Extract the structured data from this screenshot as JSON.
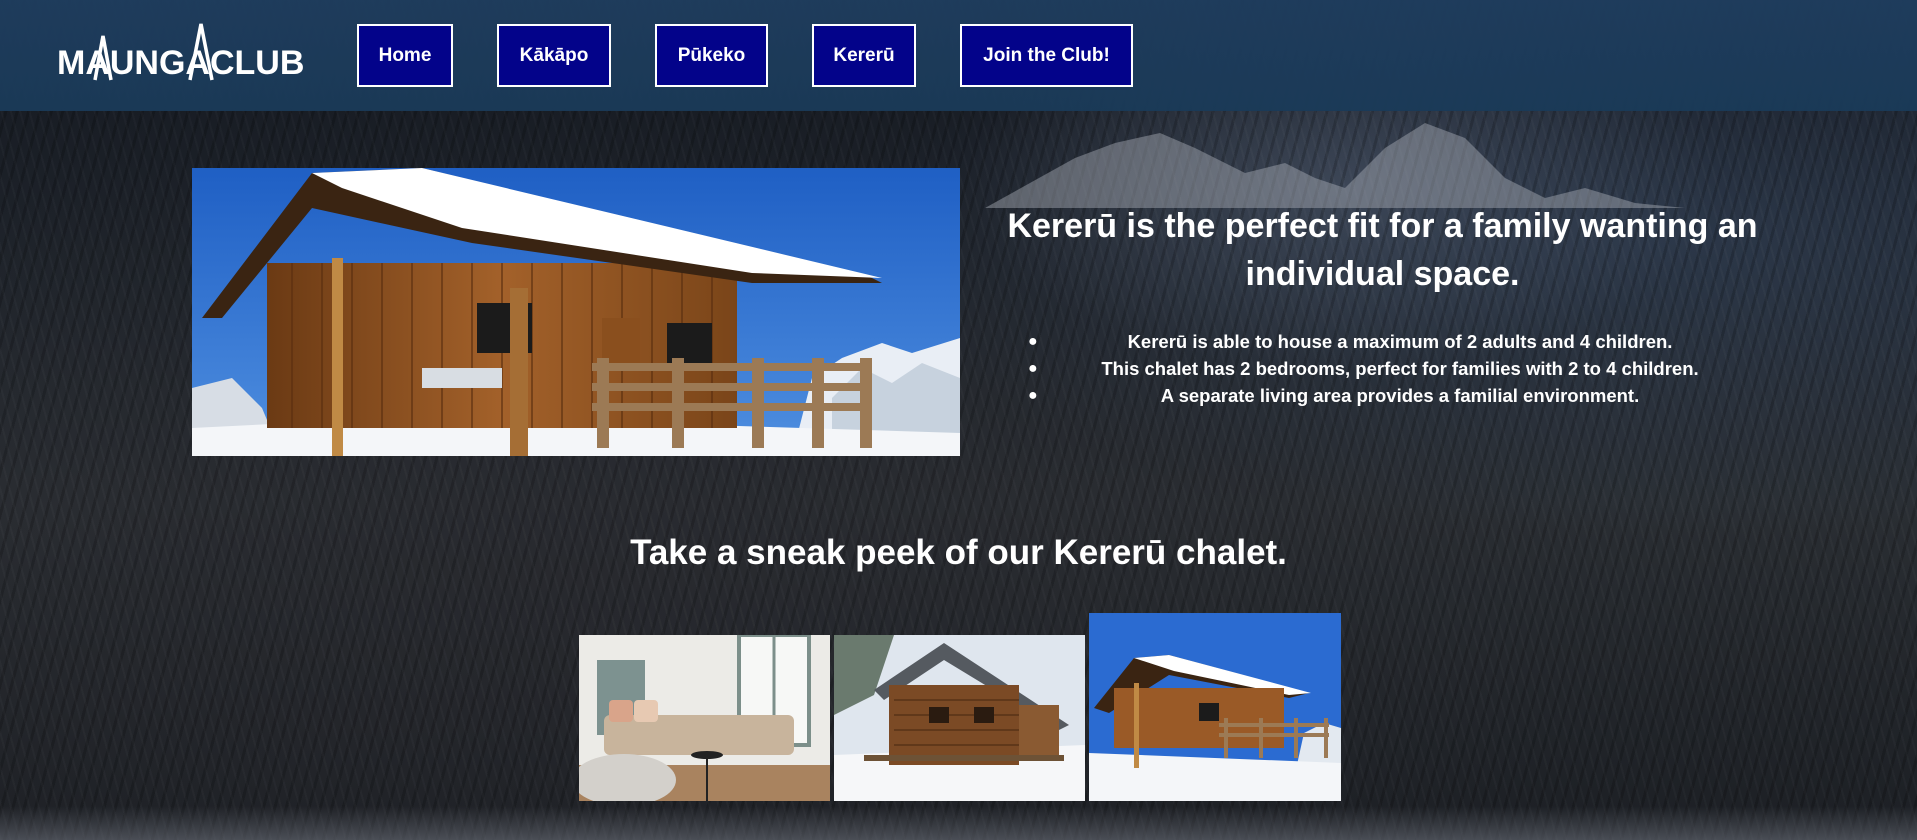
{
  "header": {
    "logo_text": "MAUNGACLUB",
    "nav": [
      {
        "label": "Home"
      },
      {
        "label": "Kākāpo"
      },
      {
        "label": "Pūkeko"
      },
      {
        "label": "Kererū"
      },
      {
        "label": "Join the Club!"
      }
    ]
  },
  "hero": {
    "heading": "Kererū is the perfect fit for a family wanting an individual space.",
    "features": [
      "Kererū is able to house a maximum of 2 adults and 4 children.",
      "This chalet has 2 bedrooms, perfect for families with 2 to 4 children.",
      "A separate living area provides a familial environment."
    ]
  },
  "gallery": {
    "title": "Take a sneak peek of our Kererū chalet."
  },
  "colors": {
    "nav_bg": "#03038a",
    "header_bg": "#1f3d5e"
  }
}
